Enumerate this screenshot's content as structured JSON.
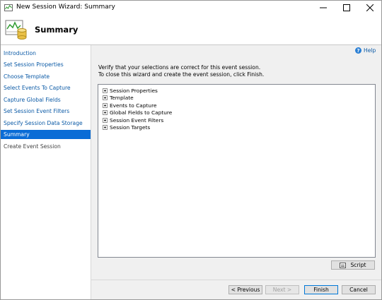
{
  "window": {
    "title": "New Session Wizard: Summary"
  },
  "header": {
    "title": "Summary"
  },
  "sidebar": {
    "items": [
      {
        "label": "Introduction"
      },
      {
        "label": "Set Session Properties"
      },
      {
        "label": "Choose Template"
      },
      {
        "label": "Select Events To Capture"
      },
      {
        "label": "Capture Global Fields"
      },
      {
        "label": "Set Session Event Filters"
      },
      {
        "label": "Specify Session Data Storage"
      },
      {
        "label": "Summary",
        "state": "selected"
      },
      {
        "label": "Create Event Session",
        "state": "disabled"
      }
    ]
  },
  "main": {
    "help_label": "Help",
    "instruction_line1": "Verify that your selections are correct for this event session.",
    "instruction_line2": "To close this wizard and create the event session, click Finish.",
    "tree": [
      {
        "label": "Session Properties"
      },
      {
        "label": "Template"
      },
      {
        "label": "Events to Capture"
      },
      {
        "label": "Global Fields to Capture"
      },
      {
        "label": "Session Event Filters"
      },
      {
        "label": "Session Targets"
      }
    ],
    "script_label": "Script"
  },
  "footer": {
    "previous_label": "< Previous",
    "next_label": "Next >",
    "finish_label": "Finish",
    "cancel_label": "Cancel"
  },
  "colors": {
    "accent": "#0a6cd6",
    "link": "#0b5aa6",
    "background": "#f0f0f0"
  }
}
